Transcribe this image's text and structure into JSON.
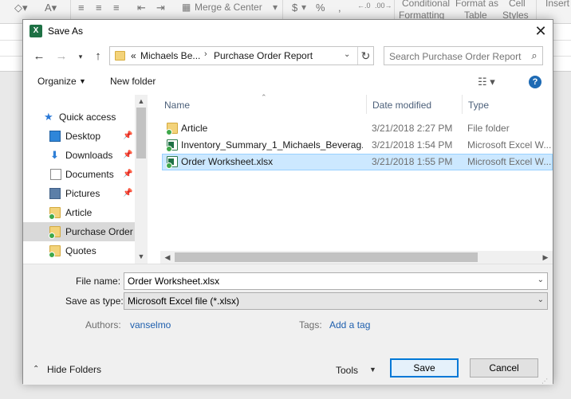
{
  "ribbon": {
    "merge_center": "Merge & Center",
    "currency": "$",
    "percent": "%",
    "comma": ",",
    "conditional": "Conditional",
    "conditional2": "Formatting",
    "format_as": "Format as",
    "format_as2": "Table",
    "cell": "Cell",
    "cell2": "Styles",
    "insert": "Insert"
  },
  "dialog": {
    "title": "Save As",
    "app_icon": "excel-icon",
    "close_glyph": "✕"
  },
  "address": {
    "prefix": "«",
    "crumbs": [
      "Michaels Be...",
      "Purchase Order Report"
    ],
    "search_placeholder": "Search Purchase Order Report"
  },
  "toolbar": {
    "organize": "Organize",
    "new_folder": "New folder"
  },
  "nav": {
    "items": [
      {
        "label": "Quick access",
        "icon": "star-icon"
      },
      {
        "label": "Desktop",
        "icon": "desktop-icon"
      },
      {
        "label": "Downloads",
        "icon": "downloads-icon"
      },
      {
        "label": "Documents",
        "icon": "documents-icon"
      },
      {
        "label": "Pictures",
        "icon": "pictures-icon"
      },
      {
        "label": "Article",
        "icon": "folder-icon"
      },
      {
        "label": "Purchase Order R",
        "icon": "folder-icon"
      },
      {
        "label": "Quotes",
        "icon": "folder-icon"
      }
    ]
  },
  "files": {
    "headers": {
      "name": "Name",
      "date": "Date modified",
      "type": "Type"
    },
    "rows": [
      {
        "name": "Article",
        "date": "3/21/2018 2:27 PM",
        "type": "File folder",
        "icon": "folder-icon"
      },
      {
        "name": "Inventory_Summary_1_Michaels_Beverag...",
        "date": "3/21/2018 1:54 PM",
        "type": "Microsoft Excel W...",
        "icon": "excel-file-icon"
      },
      {
        "name": "Order Worksheet.xlsx",
        "date": "3/21/2018 1:55 PM",
        "type": "Microsoft Excel W...",
        "icon": "excel-file-icon"
      }
    ]
  },
  "form": {
    "file_name_label": "File name:",
    "file_name_value": "Order Worksheet.xlsx",
    "save_type_label": "Save as type:",
    "save_type_value": "Microsoft Excel file (*.xlsx)",
    "authors_label": "Authors:",
    "authors_value": "vanselmo",
    "tags_label": "Tags:",
    "tags_value": "Add a tag",
    "hide_folders": "Hide Folders",
    "tools": "Tools",
    "save": "Save",
    "cancel": "Cancel"
  },
  "colors": {
    "selection": "#cce8ff",
    "accent": "#0078d7",
    "excel_green": "#1e7145",
    "link": "#1e5fae"
  }
}
